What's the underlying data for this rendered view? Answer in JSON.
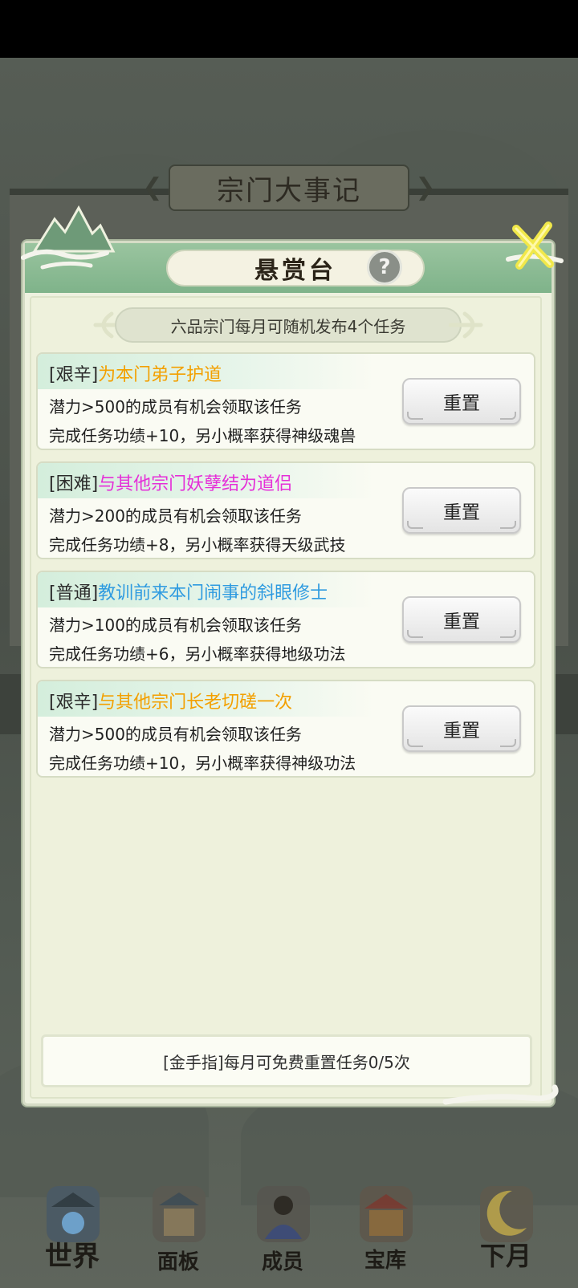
{
  "background": {
    "banner_title": "宗门大事记"
  },
  "modal": {
    "title": "悬赏台",
    "help_symbol": "?",
    "subtitle": "六品宗门每月可随机发布4个任务",
    "tasks": [
      {
        "tag": "[艰辛]",
        "name": "为本门弟子护道",
        "name_color": "#f3a000",
        "requirement": "潜力>500的成员有机会领取该任务",
        "reward": "完成任务功绩+10，另小概率获得神级魂兽",
        "button": "重置"
      },
      {
        "tag": "[困难]",
        "name": "与其他宗门妖孽结为道侣",
        "name_color": "#e52fd8",
        "requirement": "潜力>200的成员有机会领取该任务",
        "reward": "完成任务功绩+8，另小概率获得天级武技",
        "button": "重置"
      },
      {
        "tag": "[普通]",
        "name": "教训前来本门闹事的斜眼修士",
        "name_color": "#2f9be0",
        "requirement": "潜力>100的成员有机会领取该任务",
        "reward": "完成任务功绩+6，另小概率获得地级功法",
        "button": "重置"
      },
      {
        "tag": "[艰辛]",
        "name": "与其他宗门长老切磋一次",
        "name_color": "#f3a000",
        "requirement": "潜力>500的成员有机会领取该任务",
        "reward": "完成任务功绩+10，另小概率获得神级功法",
        "button": "重置"
      }
    ],
    "footer": "[金手指]每月可免费重置任务0/5次"
  },
  "nav": {
    "items": [
      {
        "label": "世界",
        "icon": "world-icon"
      },
      {
        "label": "面板",
        "icon": "panel-icon"
      },
      {
        "label": "成员",
        "icon": "members-icon"
      },
      {
        "label": "宝库",
        "icon": "treasury-icon"
      },
      {
        "label": "下月",
        "icon": "next-month-icon"
      }
    ]
  }
}
